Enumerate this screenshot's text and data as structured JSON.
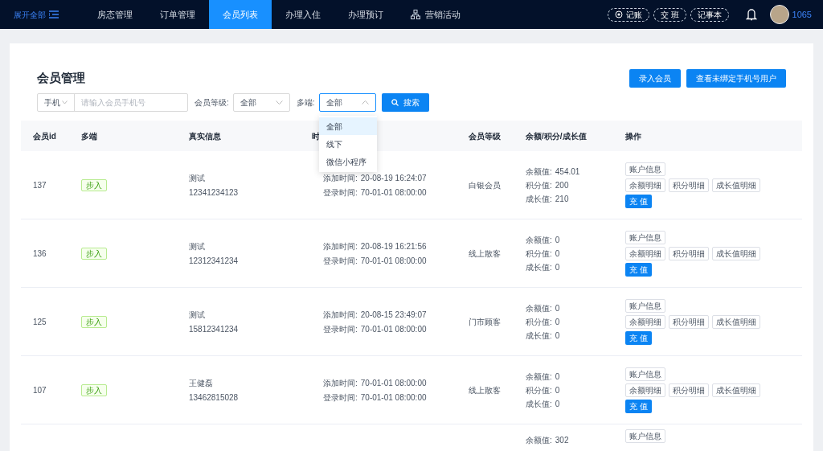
{
  "nav": {
    "expand_label": "展开全部",
    "tabs": [
      {
        "label": "房态管理",
        "selected": false,
        "kind": "plain"
      },
      {
        "label": "订单管理",
        "selected": false,
        "kind": "plain"
      },
      {
        "label": "会员列表",
        "selected": true,
        "kind": "plain"
      },
      {
        "label": "办理入住",
        "selected": false,
        "kind": "plain"
      },
      {
        "label": "办理预订",
        "selected": false,
        "kind": "plain"
      },
      {
        "label": "营销活动",
        "selected": false,
        "kind": "network"
      }
    ],
    "pills": [
      {
        "label": "记账",
        "kind": "target"
      },
      {
        "label": "交 班",
        "kind": "plain"
      },
      {
        "label": "记事本",
        "kind": "plain"
      }
    ],
    "user_id": "1065"
  },
  "page": {
    "title": "会员管理",
    "buttons": [
      "录入会员",
      "查看未绑定手机号用户"
    ],
    "filters": {
      "phone_type": "手机",
      "phone_placeholder": "请输入会员手机号",
      "level_label": "会员等级:",
      "level_value": "全部",
      "channel_label": "多端:",
      "channel_value": "全部",
      "channel_open": true,
      "channel_options": [
        {
          "label": "全部",
          "selected": true
        },
        {
          "label": "线下",
          "selected": false
        },
        {
          "label": "微信小程序",
          "selected": false
        }
      ],
      "search_button": "搜索"
    },
    "table": {
      "columns": [
        "会员id",
        "多端",
        "真实信息",
        "时",
        "会员等级",
        "余额/积分/成长值",
        "操作"
      ],
      "rows": [
        {
          "id": "137",
          "channel": "步入",
          "name": "测试",
          "phone": "12341234123",
          "added_label": "添加时间:",
          "added": "20-08-19 16:24:07",
          "login_label": "登录时间:",
          "login": "70-01-01 08:00:00",
          "level": "白银会员",
          "balance_label": "余额值:",
          "balance": "454.01",
          "points_label": "积分值:",
          "points": "200",
          "growth_label": "成长值:",
          "growth": "210",
          "actions": [
            "账户信息",
            "余额明细",
            "积分明细",
            "成长值明细"
          ],
          "recharge": "充 值"
        },
        {
          "id": "136",
          "channel": "步入",
          "name": "测试",
          "phone": "12312341234",
          "added_label": "添加时间:",
          "added": "20-08-19 16:21:56",
          "login_label": "登录时间:",
          "login": "70-01-01 08:00:00",
          "level": "线上散客",
          "balance_label": "余额值:",
          "balance": "0",
          "points_label": "积分值:",
          "points": "0",
          "growth_label": "成长值:",
          "growth": "0",
          "actions": [
            "账户信息",
            "余额明细",
            "积分明细",
            "成长值明细"
          ],
          "recharge": "充 值"
        },
        {
          "id": "125",
          "channel": "步入",
          "name": "测试",
          "phone": "15812341234",
          "added_label": "添加时间:",
          "added": "20-08-15 23:49:07",
          "login_label": "登录时间:",
          "login": "70-01-01 08:00:00",
          "level": "门市顾客",
          "balance_label": "余额值:",
          "balance": "0",
          "points_label": "积分值:",
          "points": "0",
          "growth_label": "成长值:",
          "growth": "0",
          "actions": [
            "账户信息",
            "余额明细",
            "积分明细",
            "成长值明细"
          ],
          "recharge": "充 值"
        },
        {
          "id": "107",
          "channel": "步入",
          "name": "王健磊",
          "phone": "13462815028",
          "added_label": "添加时间:",
          "added": "70-01-01 08:00:00",
          "login_label": "登录时间:",
          "login": "70-01-01 08:00:00",
          "level": "线上散客",
          "balance_label": "余额值:",
          "balance": "0",
          "points_label": "积分值:",
          "points": "0",
          "growth_label": "成长值:",
          "growth": "0",
          "actions": [
            "账户信息",
            "余额明细",
            "积分明细",
            "成长值明细"
          ],
          "recharge": "充 值"
        }
      ],
      "partial_row": {
        "balance_label": "余额值:",
        "balance": "302",
        "action": "账户信息"
      }
    }
  }
}
